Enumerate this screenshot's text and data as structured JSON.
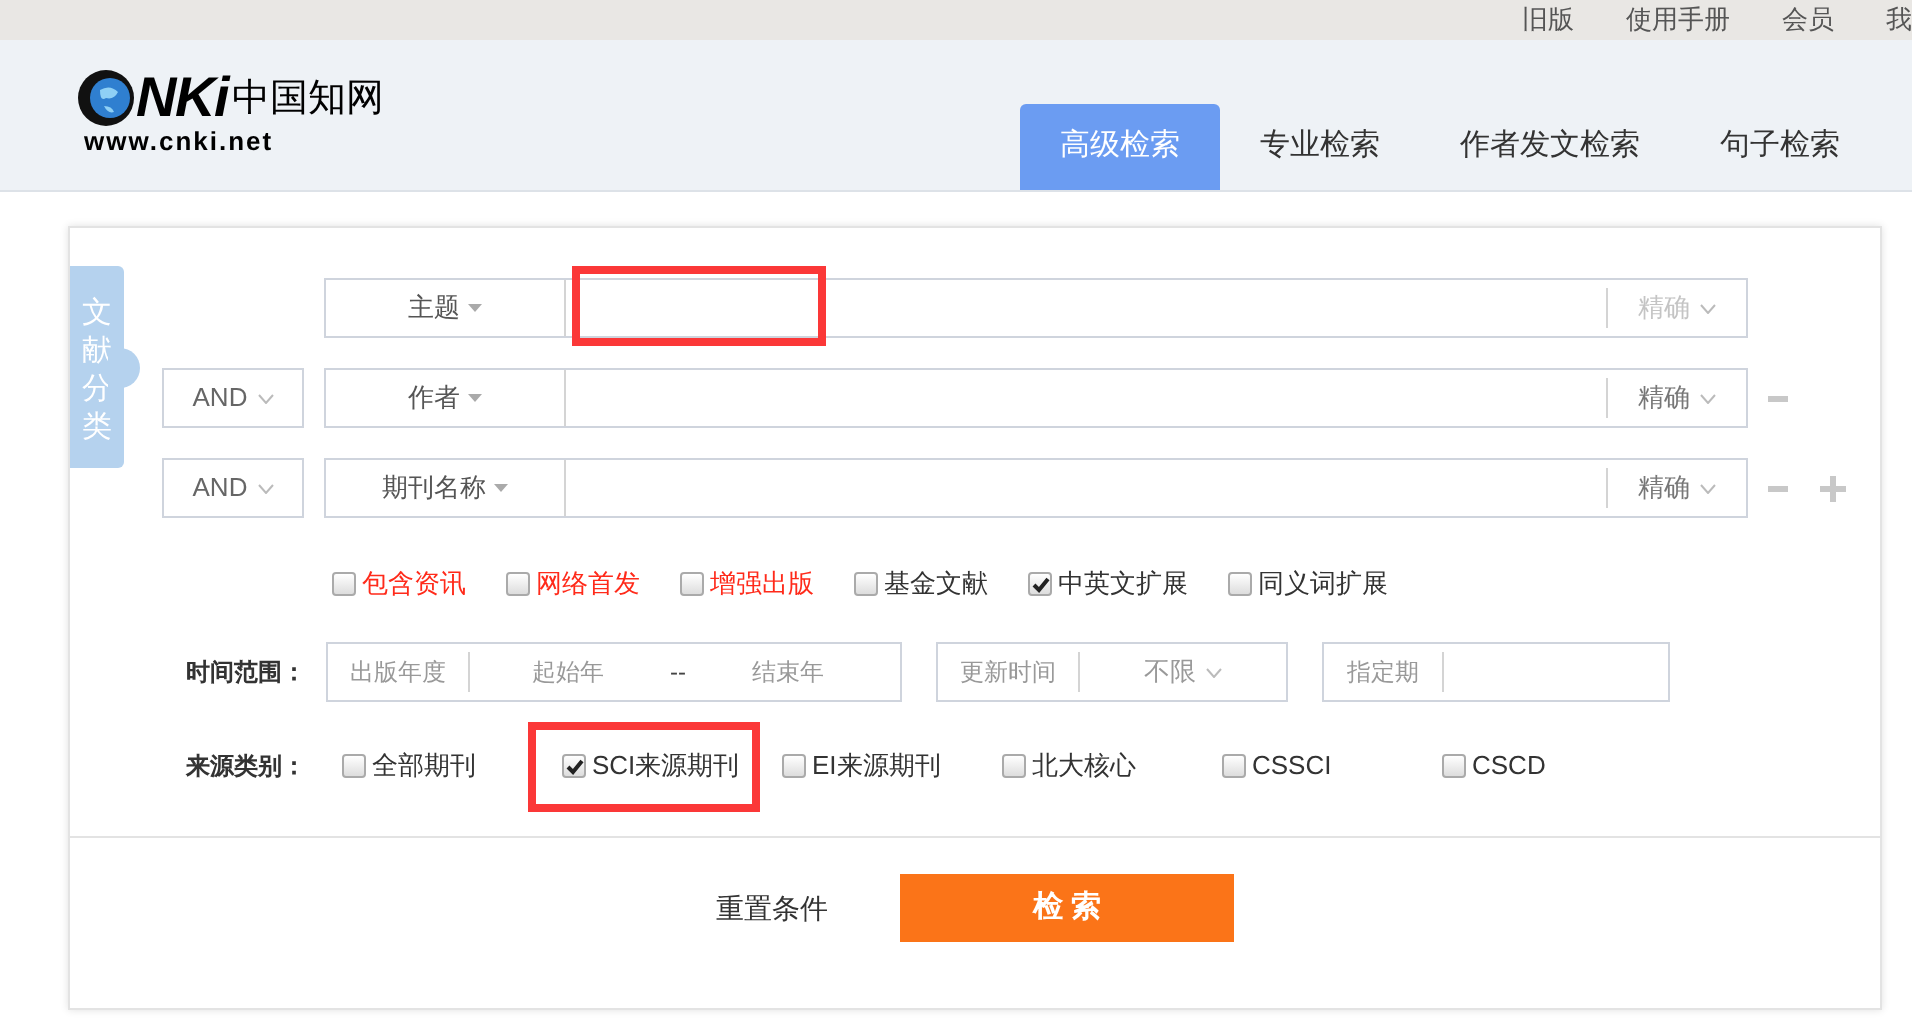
{
  "top_links": [
    "旧版",
    "使用手册",
    "会员",
    "我"
  ],
  "logo": {
    "mark": "NKi",
    "name": "中国知网",
    "url": "www.cnki.net"
  },
  "tabs": [
    {
      "label": "高级检索",
      "selected": true
    },
    {
      "label": "专业检索",
      "selected": false
    },
    {
      "label": "作者发文检索",
      "selected": false
    },
    {
      "label": "句子检索",
      "selected": false
    }
  ],
  "sidebar_tab": {
    "label": "文献分类"
  },
  "search_rows": [
    {
      "field": "主题",
      "match": "精确",
      "match_dimmed": true,
      "highlighted": true,
      "can_remove": false,
      "can_add": false
    },
    {
      "logic": "AND",
      "field": "作者",
      "match": "精确",
      "match_dimmed": false,
      "highlighted": false,
      "can_remove": true,
      "can_add": false
    },
    {
      "logic": "AND",
      "field": "期刊名称",
      "match": "精确",
      "match_dimmed": false,
      "highlighted": false,
      "can_remove": true,
      "can_add": true
    }
  ],
  "options": [
    {
      "label": "包含资讯",
      "checked": false,
      "color": "#ff2a1a"
    },
    {
      "label": "网络首发",
      "checked": false,
      "color": "#ff2a1a"
    },
    {
      "label": "增强出版",
      "checked": false,
      "color": "#ff2a1a"
    },
    {
      "label": "基金文献",
      "checked": false,
      "color": "#333333"
    },
    {
      "label": "中英文扩展",
      "checked": true,
      "color": "#333333"
    },
    {
      "label": "同义词扩展",
      "checked": false,
      "color": "#333333"
    }
  ],
  "time_range": {
    "label": "时间范围：",
    "year": {
      "label": "出版年度",
      "from_placeholder": "起始年",
      "separator": "--",
      "to_placeholder": "结束年"
    },
    "update": {
      "label": "更新时间",
      "value": "不限"
    },
    "period": {
      "label": "指定期"
    }
  },
  "source": {
    "label": "来源类别：",
    "items": [
      {
        "label": "全部期刊",
        "checked": false,
        "highlighted": false
      },
      {
        "label": "SCI来源期刊",
        "checked": true,
        "highlighted": true
      },
      {
        "label": "EI来源期刊",
        "checked": false,
        "highlighted": false
      },
      {
        "label": "北大核心",
        "checked": false,
        "highlighted": false
      },
      {
        "label": "CSSCI",
        "checked": false,
        "highlighted": false
      },
      {
        "label": "CSCD",
        "checked": false,
        "highlighted": false
      }
    ]
  },
  "buttons": {
    "reset": "重置条件",
    "search": "检 索"
  }
}
